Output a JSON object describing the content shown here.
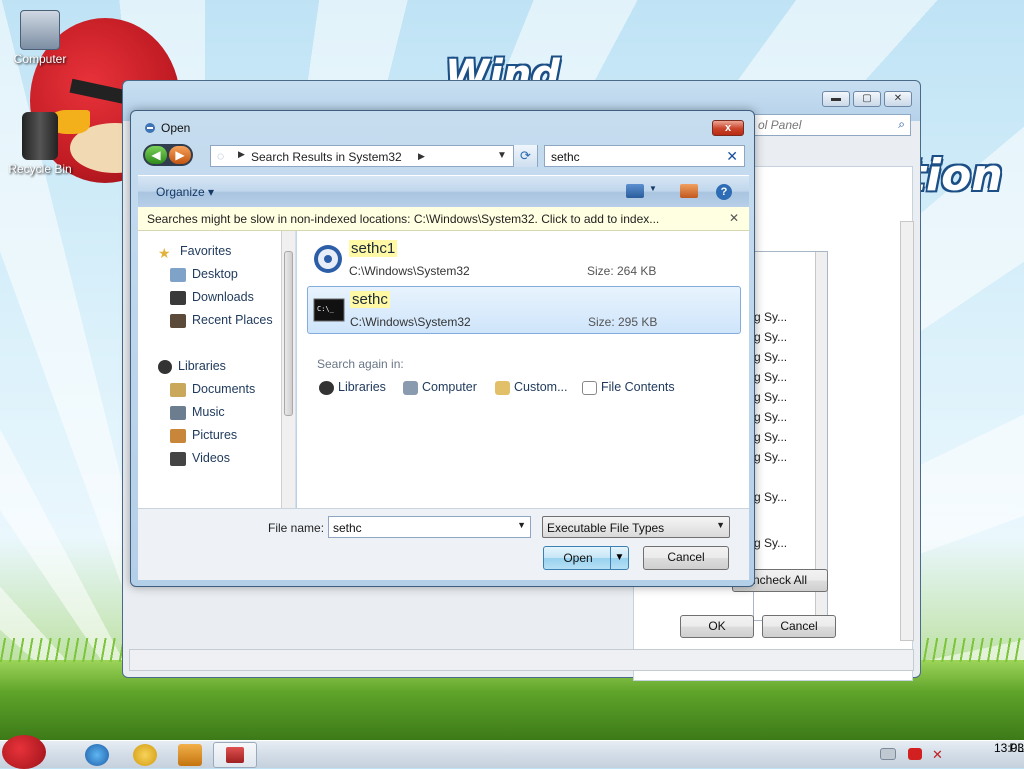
{
  "desktop": {
    "icons": [
      {
        "label": "Computer"
      },
      {
        "label": "Recycle Bin"
      }
    ],
    "wallpaper_text": [
      "Wind",
      "tion"
    ]
  },
  "bg_window": {
    "search_placeholder": "ol Panel",
    "list_rows": [
      "g Sy...",
      "g Sy...",
      "g Sy...",
      "g Sy...",
      "g Sy...",
      "g Sy...",
      "g Sy...",
      "g Sy...",
      "g Sy...",
      "g Sy..."
    ],
    "uncheck_all": "ncheck All",
    "ok": "OK",
    "cancel": "Cancel"
  },
  "dialog": {
    "title": "Open",
    "close": "x",
    "breadcrumb": "Search Results in System32",
    "search_value": "sethc",
    "organize": "Organize",
    "info_bar": "Searches might be slow in non-indexed locations: C:\\Windows\\System32. Click to add to index...",
    "nav": {
      "favorites": "Favorites",
      "favorite_items": [
        "Desktop",
        "Downloads",
        "Recent Places"
      ],
      "libraries": "Libraries",
      "library_items": [
        "Documents",
        "Music",
        "Pictures",
        "Videos"
      ]
    },
    "results": [
      {
        "name": "sethc1",
        "path": "C:\\Windows\\System32",
        "size": "Size: 264 KB",
        "icon": "gear-exe-icon"
      },
      {
        "name": "sethc",
        "path": "C:\\Windows\\System32",
        "size": "Size: 295 KB",
        "icon": "console-exe-icon"
      }
    ],
    "search_again": "Search again in:",
    "search_again_locations": [
      "Libraries",
      "Computer",
      "Custom...",
      "File Contents"
    ],
    "file_name_label": "File name:",
    "file_name_value": "sethc",
    "file_type": "Executable File Types",
    "open_button": "Open",
    "cancel_button": "Cancel"
  },
  "taskbar": {
    "language": "PL",
    "clock": "13:03"
  },
  "colors": {
    "accent": "#3c7fb1",
    "highlight": "#fff9a6",
    "selection": "#cfe5fb"
  }
}
